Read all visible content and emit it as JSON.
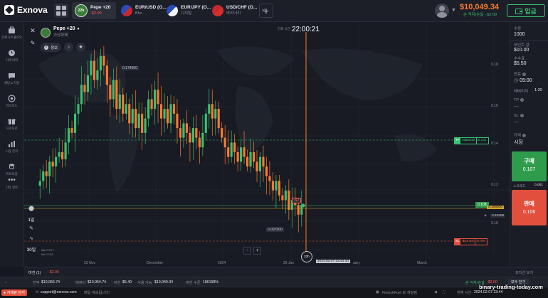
{
  "app": {
    "name": "Exnova",
    "deposit_label": "입금",
    "balance": "$10,049.34",
    "balance_sub": "손 익자/손실 - $2.00"
  },
  "colors": {
    "up": "#38c172",
    "down": "#ff7a2e",
    "sell": "#e2503d",
    "accent": "#ff7a2e"
  },
  "tabs": [
    {
      "title": "Pepe +20",
      "sub": "-$2.00",
      "icon": "pepe-avatar-icon",
      "active": true,
      "badge": "22h"
    },
    {
      "title": "EUR/USD (O...",
      "sub": "Bho",
      "icon": "eur-usd-flag-icon"
    },
    {
      "title": "EUR/JPY (O...",
      "sub": "디지털",
      "icon": "eur-jpy-flag-icon"
    },
    {
      "title": "USD/CHF (O...",
      "sub": "바이너리",
      "icon": "usd-chf-flag-icon"
    }
  ],
  "sidebar": [
    {
      "label": "전체 포트폴리오",
      "icon": "portfolio-icon"
    },
    {
      "label": "거래 내역",
      "icon": "history-icon"
    },
    {
      "label": "채팅 & 지원",
      "icon": "chat-icon"
    },
    {
      "label": "리더보드",
      "icon": "leaderboard-icon"
    },
    {
      "label": "프로모션",
      "icon": "promotion-icon"
    },
    {
      "label": "시장 분석",
      "icon": "market-analysis-icon"
    },
    {
      "label": "튜토리얼",
      "icon": "tutorial-icon"
    },
    {
      "label": "기타 항목",
      "icon": "more-icon"
    }
  ],
  "chart": {
    "asset": "Pepe +20",
    "asset_sub": "가상화폐",
    "info_label": "정보",
    "timer": "22:00:21",
    "timer_label": "만료 시간",
    "x_labels": [
      "23 Nov",
      "December",
      "2024",
      "25 Jan",
      "uary",
      "March"
    ],
    "y_labels": [
      "0.18",
      "0.16",
      "0.14",
      "0.12",
      "0.10"
    ],
    "tp_label": "TP",
    "tp_amount": "+$33.00",
    "tp_price": "0.141",
    "sl_label": "SL",
    "sl_amount": "-$18.00",
    "sl_price": "0.090",
    "high_label": "0.174500",
    "low_label": "0.097500",
    "current_price": "0.108",
    "current_price_line": "0.106500",
    "order_price": "0.10205",
    "position_badge": "-$2",
    "time_label": "2024.02.07 23:44:44",
    "expiry_badge": "22h",
    "timeframe": "1일",
    "period": "30일",
    "zoom_minus": "-",
    "zoom_plus": "+",
    "stat1": "ask 0.107",
    "stat2": "bid 0.106"
  },
  "chart_data": {
    "type": "candlestick",
    "x": [
      "23 Nov",
      "December",
      "2024",
      "25 Jan",
      "uary",
      "March"
    ],
    "ohlc_note": "",
    "high": 0.1745,
    "low": 0.0975,
    "last": 0.108,
    "ylim": [
      0.09,
      0.18
    ]
  },
  "right_panel": {
    "investment_label": "수량",
    "investment_value": "1000",
    "point_label": "포인트 값",
    "point_value": "$10.00",
    "commission_label": "수수료",
    "commission_value": "$5.50",
    "expiry_label": "만료",
    "expiry_value": "05:00",
    "leverage_label": "레버리지",
    "leverage_value": "1:20",
    "tp_label": "TP",
    "tp_value": "---",
    "sl_label": "SL",
    "sl_value": "---",
    "price_label": "가격",
    "price_value": "시장",
    "buy_label": "구매",
    "buy_price": "0.107",
    "spread_label": "스프레드",
    "spread_value": "0.001",
    "sell_label": "판매",
    "sell_price": "0.106"
  },
  "margin_bar": {
    "label": "마진 (1)",
    "value": "-$2.00",
    "right_label": "포지션 보기"
  },
  "summary": {
    "balance_label": "잔액",
    "balance": "$10,056.74",
    "equity_label": "에퀴티",
    "equity": "$10,054.74",
    "margin_label": "마진",
    "margin": "$5.40",
    "available_label": "사용 가능",
    "available": "$10,049.34",
    "level_label": "마진 수준",
    "level": "186198%",
    "pnl_label": "손 익자/손실",
    "pnl": "-$2.00",
    "close_all": "모두 닫기"
  },
  "status": {
    "badge": "거래량 감지",
    "email": "support@exnova.com",
    "tagline": "매일 계속됩니다!",
    "provider": "FintechFuel 로 개발됨",
    "time_label": "현재 시간:",
    "time_value": "2024.02.07 23:44",
    "watermark": "binary-trading-today.com"
  }
}
